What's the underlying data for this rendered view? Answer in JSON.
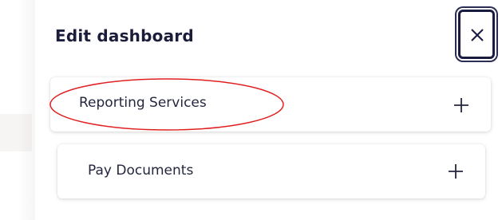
{
  "panel": {
    "title": "Edit dashboard",
    "close_icon": "close-icon",
    "items": [
      {
        "label": "Reporting Services",
        "icon": "plus-icon",
        "highlighted": true
      },
      {
        "label": "Pay Documents",
        "icon": "plus-icon",
        "highlighted": false
      }
    ]
  },
  "colors": {
    "text_dark": "#1b1d3a",
    "close_border": "#1a1b40",
    "highlight": "#e02020"
  }
}
